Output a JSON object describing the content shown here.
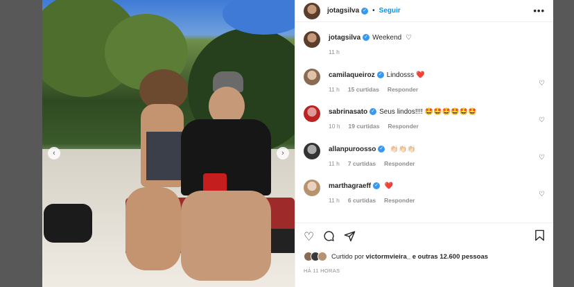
{
  "post": {
    "username": "jotagsilva",
    "follow_label": "Seguir",
    "more_label": "•••",
    "caption": "Weekend",
    "caption_time": "11 h"
  },
  "comments": [
    {
      "user": "camilaqueiroz",
      "text": "Lindosss",
      "emoji": "❤️",
      "time": "11 h",
      "likes": "15 curtidas",
      "reply": "Responder"
    },
    {
      "user": "sabrinasato",
      "text": "Seus lindos!!!!",
      "emoji": "🤩🤩🤩🤩🤩🤩",
      "time": "10 h",
      "likes": "19 curtidas",
      "reply": "Responder"
    },
    {
      "user": "allanpuroosso",
      "text": "",
      "emoji": "👏🏻👏🏻👏🏻",
      "time": "11 h",
      "likes": "7 curtidas",
      "reply": "Responder"
    },
    {
      "user": "marthagraeff",
      "text": "",
      "emoji": "❤️",
      "time": "11 h",
      "likes": "6 curtidas",
      "reply": "Responder"
    }
  ],
  "likes": {
    "prefix": "Curtido por",
    "user": "victormvieira_",
    "suffix": "e outras 12.600 pessoas"
  },
  "date": "HÁ 11 HORAS",
  "icons": [
    "heart-icon",
    "comment-icon",
    "share-icon",
    "bookmark-icon",
    "chevron-left-icon",
    "chevron-right-icon"
  ]
}
